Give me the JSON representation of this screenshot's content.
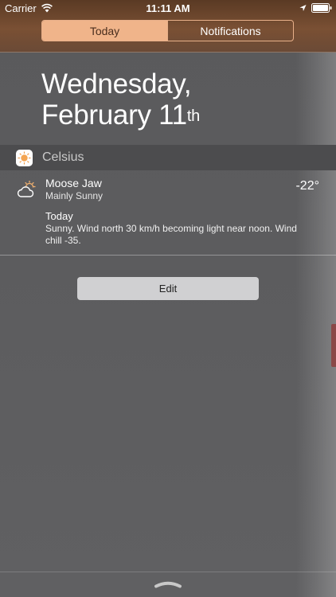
{
  "status_bar": {
    "carrier": "Carrier",
    "time": "11:11 AM",
    "icons": [
      "wifi-icon",
      "location-arrow-icon",
      "battery-icon"
    ]
  },
  "segmented_control": {
    "tabs": [
      {
        "label": "Today",
        "selected": true
      },
      {
        "label": "Notifications",
        "selected": false
      }
    ]
  },
  "date_header": {
    "line1": "Wednesday,",
    "line2": "February 11",
    "suffix": "th"
  },
  "widget": {
    "name": "Celsius",
    "icon": "sun-app-icon",
    "location": "Moose Jaw",
    "condition": "Mainly Sunny",
    "condition_icon": "partly-sunny-icon",
    "temperature": "-22°",
    "forecast_day": "Today",
    "forecast_text": "Sunny. Wind north 30 km/h becoming light near noon. Wind chill -35."
  },
  "actions": {
    "edit_label": "Edit"
  },
  "colors": {
    "accent": "#f0b48a",
    "background": "#5e5e60",
    "widget_header": "#4c4c4e"
  }
}
